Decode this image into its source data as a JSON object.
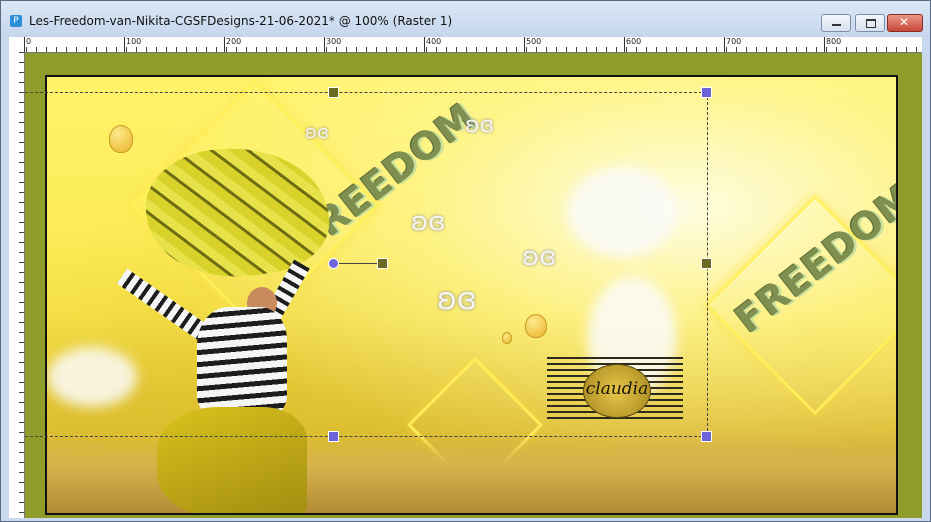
{
  "window": {
    "title": "Les-Freedom-van-Nikita-CGSFDesigns-21-06-2021* @ 100% (Raster 1)",
    "minimize_label": "",
    "maximize_label": "",
    "close_label": ""
  },
  "ruler": {
    "top_ticks": [
      "0",
      "100",
      "200",
      "300",
      "400",
      "500",
      "600",
      "700",
      "800"
    ]
  },
  "canvas": {
    "headline_1": "FREEDOM",
    "headline_2": "FREEDOM",
    "watermark": "claudia",
    "colors": {
      "workspace": "#8f9d2b",
      "handle": "#6c63d9",
      "headline": "#7f8f4f"
    }
  },
  "icons": {
    "app": "paintshop-icon",
    "butterfly": "butterfly-icon",
    "balloon": "hot-air-balloon-icon"
  }
}
